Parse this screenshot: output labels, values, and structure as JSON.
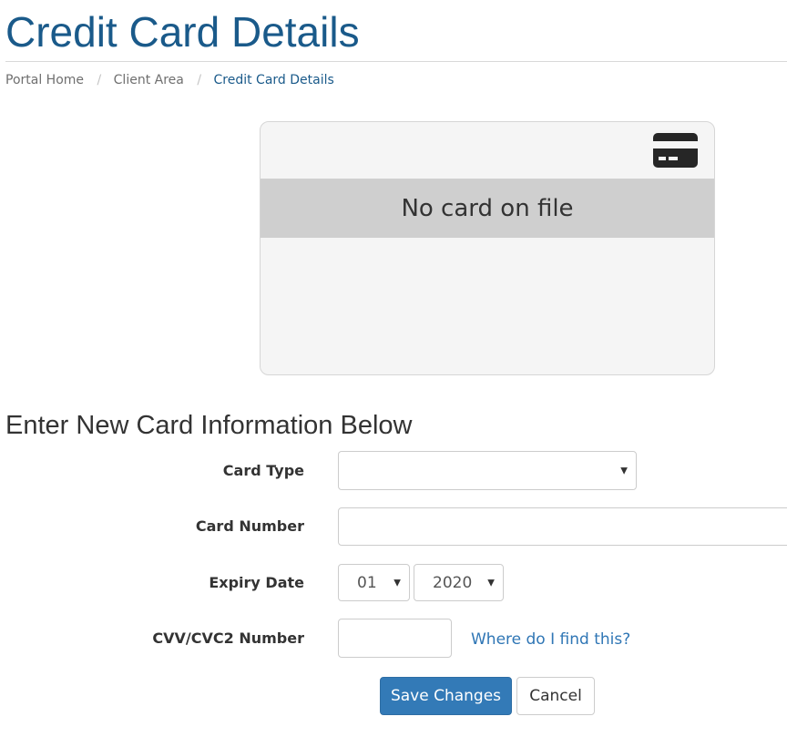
{
  "page": {
    "title": "Credit Card Details",
    "accent_color": "#1a5a8a",
    "link_color": "#2f76b5",
    "primary_button_color": "#337ab7"
  },
  "breadcrumb": {
    "items": [
      {
        "label": "Portal Home"
      },
      {
        "label": "Client Area"
      },
      {
        "label": "Credit Card Details"
      }
    ],
    "separator": "/"
  },
  "card_preview": {
    "icon": "credit-card-icon",
    "message": "No card on file"
  },
  "form": {
    "heading": "Enter New Card Information Below",
    "card_type": {
      "label": "Card Type",
      "value": ""
    },
    "card_number": {
      "label": "Card Number",
      "value": "",
      "placeholder": ""
    },
    "expiry": {
      "label": "Expiry Date",
      "month": "01",
      "year": "2020"
    },
    "cvv": {
      "label": "CVV/CVC2 Number",
      "value": "",
      "help_link": "Where do I find this?"
    },
    "save_label": "Save Changes",
    "cancel_label": "Cancel"
  }
}
